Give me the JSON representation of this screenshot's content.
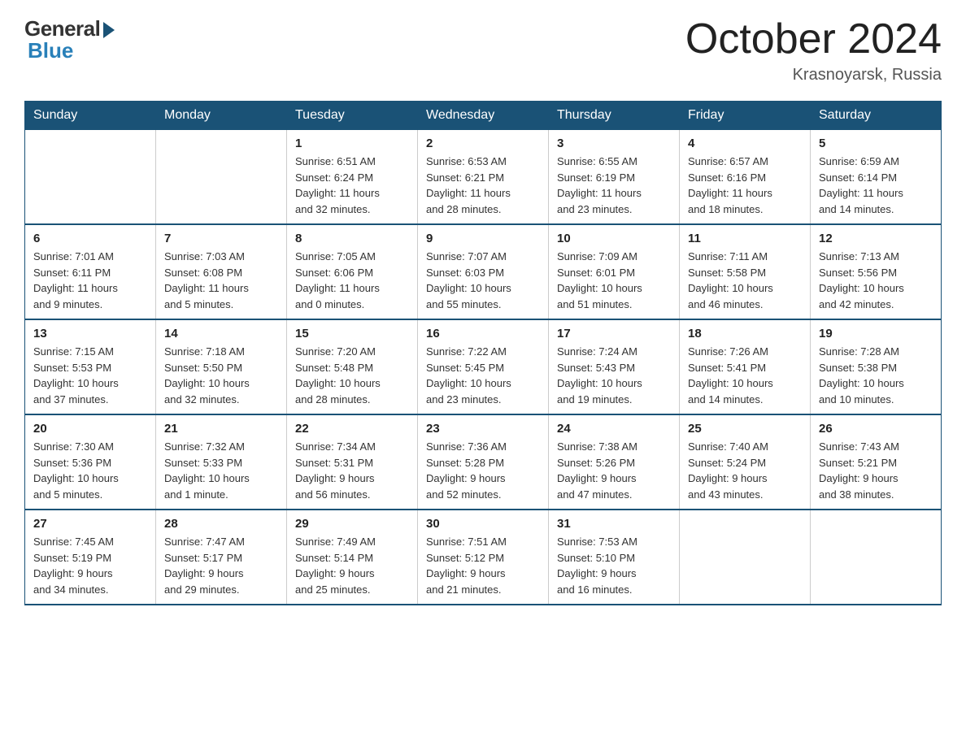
{
  "logo": {
    "general": "General",
    "blue": "Blue"
  },
  "title": {
    "month": "October 2024",
    "location": "Krasnoyarsk, Russia"
  },
  "weekdays": [
    "Sunday",
    "Monday",
    "Tuesday",
    "Wednesday",
    "Thursday",
    "Friday",
    "Saturday"
  ],
  "weeks": [
    [
      {
        "day": "",
        "info": ""
      },
      {
        "day": "",
        "info": ""
      },
      {
        "day": "1",
        "info": "Sunrise: 6:51 AM\nSunset: 6:24 PM\nDaylight: 11 hours\nand 32 minutes."
      },
      {
        "day": "2",
        "info": "Sunrise: 6:53 AM\nSunset: 6:21 PM\nDaylight: 11 hours\nand 28 minutes."
      },
      {
        "day": "3",
        "info": "Sunrise: 6:55 AM\nSunset: 6:19 PM\nDaylight: 11 hours\nand 23 minutes."
      },
      {
        "day": "4",
        "info": "Sunrise: 6:57 AM\nSunset: 6:16 PM\nDaylight: 11 hours\nand 18 minutes."
      },
      {
        "day": "5",
        "info": "Sunrise: 6:59 AM\nSunset: 6:14 PM\nDaylight: 11 hours\nand 14 minutes."
      }
    ],
    [
      {
        "day": "6",
        "info": "Sunrise: 7:01 AM\nSunset: 6:11 PM\nDaylight: 11 hours\nand 9 minutes."
      },
      {
        "day": "7",
        "info": "Sunrise: 7:03 AM\nSunset: 6:08 PM\nDaylight: 11 hours\nand 5 minutes."
      },
      {
        "day": "8",
        "info": "Sunrise: 7:05 AM\nSunset: 6:06 PM\nDaylight: 11 hours\nand 0 minutes."
      },
      {
        "day": "9",
        "info": "Sunrise: 7:07 AM\nSunset: 6:03 PM\nDaylight: 10 hours\nand 55 minutes."
      },
      {
        "day": "10",
        "info": "Sunrise: 7:09 AM\nSunset: 6:01 PM\nDaylight: 10 hours\nand 51 minutes."
      },
      {
        "day": "11",
        "info": "Sunrise: 7:11 AM\nSunset: 5:58 PM\nDaylight: 10 hours\nand 46 minutes."
      },
      {
        "day": "12",
        "info": "Sunrise: 7:13 AM\nSunset: 5:56 PM\nDaylight: 10 hours\nand 42 minutes."
      }
    ],
    [
      {
        "day": "13",
        "info": "Sunrise: 7:15 AM\nSunset: 5:53 PM\nDaylight: 10 hours\nand 37 minutes."
      },
      {
        "day": "14",
        "info": "Sunrise: 7:18 AM\nSunset: 5:50 PM\nDaylight: 10 hours\nand 32 minutes."
      },
      {
        "day": "15",
        "info": "Sunrise: 7:20 AM\nSunset: 5:48 PM\nDaylight: 10 hours\nand 28 minutes."
      },
      {
        "day": "16",
        "info": "Sunrise: 7:22 AM\nSunset: 5:45 PM\nDaylight: 10 hours\nand 23 minutes."
      },
      {
        "day": "17",
        "info": "Sunrise: 7:24 AM\nSunset: 5:43 PM\nDaylight: 10 hours\nand 19 minutes."
      },
      {
        "day": "18",
        "info": "Sunrise: 7:26 AM\nSunset: 5:41 PM\nDaylight: 10 hours\nand 14 minutes."
      },
      {
        "day": "19",
        "info": "Sunrise: 7:28 AM\nSunset: 5:38 PM\nDaylight: 10 hours\nand 10 minutes."
      }
    ],
    [
      {
        "day": "20",
        "info": "Sunrise: 7:30 AM\nSunset: 5:36 PM\nDaylight: 10 hours\nand 5 minutes."
      },
      {
        "day": "21",
        "info": "Sunrise: 7:32 AM\nSunset: 5:33 PM\nDaylight: 10 hours\nand 1 minute."
      },
      {
        "day": "22",
        "info": "Sunrise: 7:34 AM\nSunset: 5:31 PM\nDaylight: 9 hours\nand 56 minutes."
      },
      {
        "day": "23",
        "info": "Sunrise: 7:36 AM\nSunset: 5:28 PM\nDaylight: 9 hours\nand 52 minutes."
      },
      {
        "day": "24",
        "info": "Sunrise: 7:38 AM\nSunset: 5:26 PM\nDaylight: 9 hours\nand 47 minutes."
      },
      {
        "day": "25",
        "info": "Sunrise: 7:40 AM\nSunset: 5:24 PM\nDaylight: 9 hours\nand 43 minutes."
      },
      {
        "day": "26",
        "info": "Sunrise: 7:43 AM\nSunset: 5:21 PM\nDaylight: 9 hours\nand 38 minutes."
      }
    ],
    [
      {
        "day": "27",
        "info": "Sunrise: 7:45 AM\nSunset: 5:19 PM\nDaylight: 9 hours\nand 34 minutes."
      },
      {
        "day": "28",
        "info": "Sunrise: 7:47 AM\nSunset: 5:17 PM\nDaylight: 9 hours\nand 29 minutes."
      },
      {
        "day": "29",
        "info": "Sunrise: 7:49 AM\nSunset: 5:14 PM\nDaylight: 9 hours\nand 25 minutes."
      },
      {
        "day": "30",
        "info": "Sunrise: 7:51 AM\nSunset: 5:12 PM\nDaylight: 9 hours\nand 21 minutes."
      },
      {
        "day": "31",
        "info": "Sunrise: 7:53 AM\nSunset: 5:10 PM\nDaylight: 9 hours\nand 16 minutes."
      },
      {
        "day": "",
        "info": ""
      },
      {
        "day": "",
        "info": ""
      }
    ]
  ]
}
